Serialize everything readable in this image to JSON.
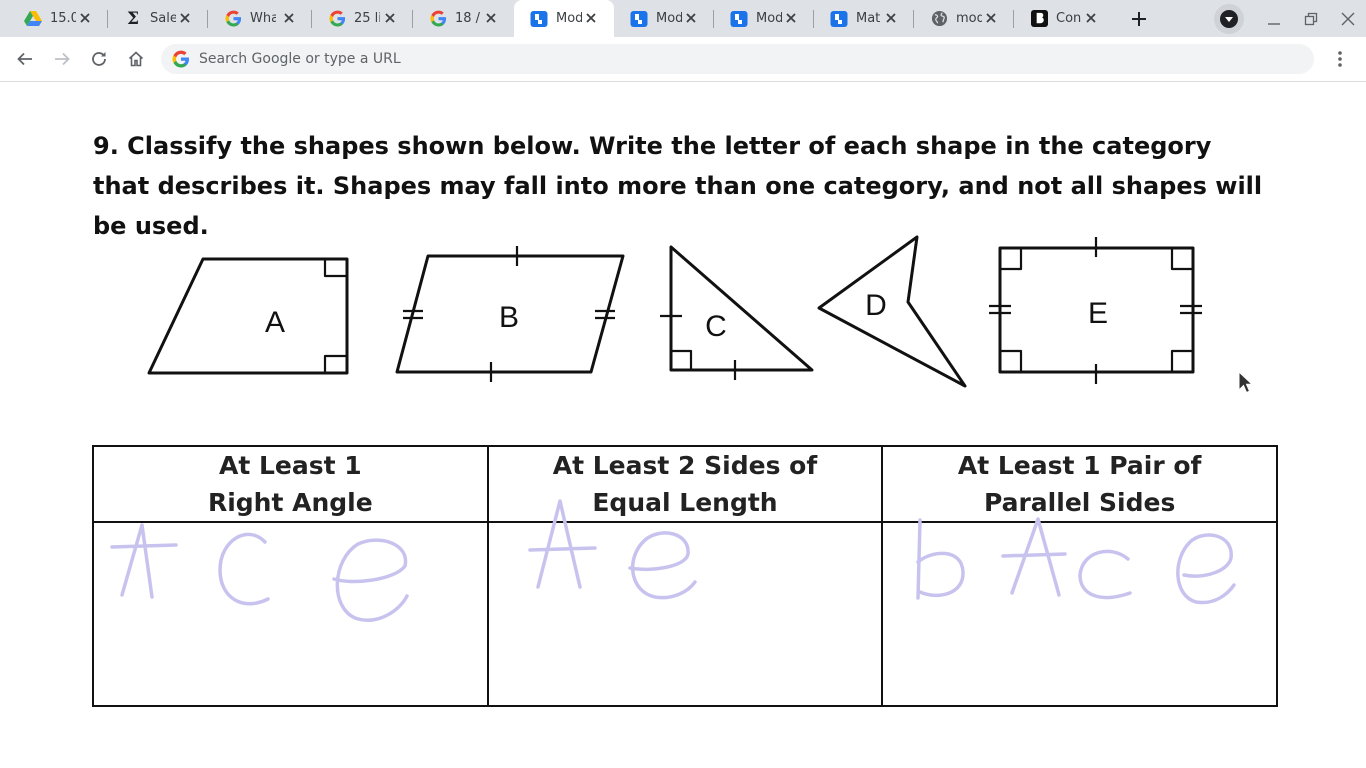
{
  "browser": {
    "tabs": [
      {
        "title": "15.0",
        "icon": "google-drive-icon"
      },
      {
        "title": "Sale",
        "icon": "sigma-icon"
      },
      {
        "title": "Wha",
        "icon": "google-icon"
      },
      {
        "title": "25 li",
        "icon": "google-icon"
      },
      {
        "title": "18 /",
        "icon": "google-icon"
      },
      {
        "title": "Mod",
        "icon": "quizizz-icon",
        "active": true
      },
      {
        "title": "Mod",
        "icon": "quizizz-icon"
      },
      {
        "title": "Mod",
        "icon": "quizizz-icon"
      },
      {
        "title": "Mat",
        "icon": "quizizz-icon"
      },
      {
        "title": "mod",
        "icon": "globe-icon"
      },
      {
        "title": "Con",
        "icon": "brainly-icon"
      }
    ],
    "omnibox": {
      "placeholder": "Search Google or type a URL"
    }
  },
  "worksheet": {
    "question": "9. Classify the shapes shown below. Write the letter of each shape in the category that describes it. Shapes may fall into more than one category, and not all shapes will be used.",
    "shape_labels": [
      "A",
      "B",
      "C",
      "D",
      "E"
    ],
    "columns": [
      {
        "header_line1": "At Least 1",
        "header_line2": "Right Angle",
        "answers": "A C e"
      },
      {
        "header_line1": "At Least 2 Sides of",
        "header_line2": "Equal Length",
        "answers": "A e"
      },
      {
        "header_line1": "At Least 1 Pair of",
        "header_line2": "Parallel Sides",
        "answers": "b A c e"
      }
    ],
    "handwriting_color": "#c8c3ee"
  }
}
